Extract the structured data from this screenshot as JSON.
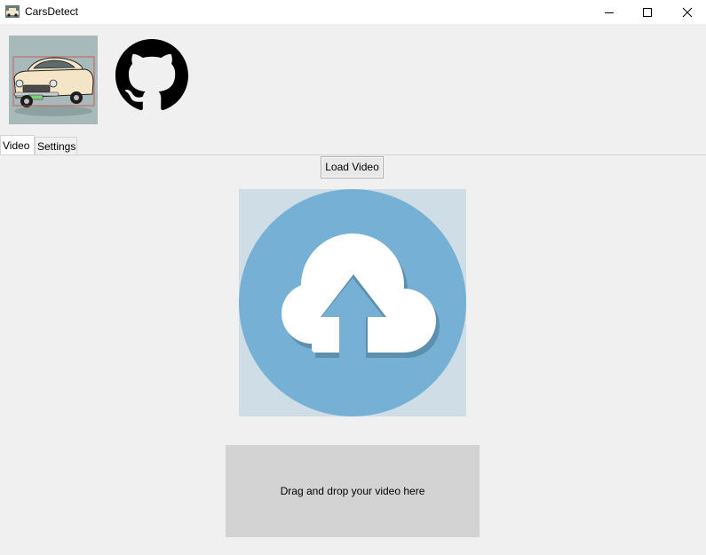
{
  "window": {
    "title": "CarsDetect",
    "app_icon": "car-app-icon",
    "controls": [
      "minimize-icon",
      "maximize-icon",
      "close-icon"
    ]
  },
  "header": {
    "logos": [
      "car-logo-image",
      "github-icon"
    ]
  },
  "tabs": [
    {
      "label": "Video",
      "active": true
    },
    {
      "label": "Settings",
      "active": false
    }
  ],
  "video_tab": {
    "load_button_label": "Load Video",
    "upload_icon": "cloud-upload-icon",
    "drop_zone_text": "Drag and drop your video here"
  },
  "colors": {
    "upload_circle": "#76b1d5",
    "upload_bg": "#cfdee6",
    "drop_zone_bg": "#d3d3d3"
  }
}
